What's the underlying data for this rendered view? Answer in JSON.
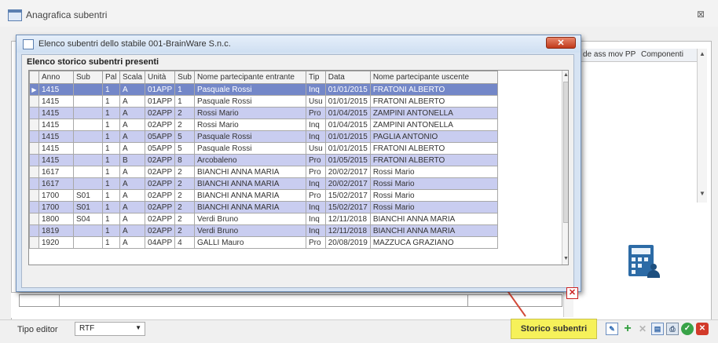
{
  "window": {
    "title": "Anagrafica subentri",
    "close_glyph": "⊠"
  },
  "background_grid": {
    "columns": [
      "de ass mov PP",
      "Componenti"
    ]
  },
  "dialog": {
    "title": "Elenco subentri dello stabile 001-BrainWare S.n.c.",
    "close_glyph": "✕",
    "group_title": "Elenco storico subentri presenti",
    "exit_glyph": "✕"
  },
  "table": {
    "columns": [
      "Anno",
      "Sub",
      "Pal",
      "Scala",
      "Unità",
      "Sub",
      "Nome partecipante entrante",
      "Tip",
      "Data",
      "Nome partecipante uscente"
    ],
    "rows": [
      [
        "1415",
        "",
        "1",
        "A",
        "01APP",
        "1",
        "Pasquale Rossi",
        "Inq",
        "01/01/2015",
        "FRATONI ALBERTO"
      ],
      [
        "1415",
        "",
        "1",
        "A",
        "01APP",
        "1",
        "Pasquale Rossi",
        "Usu",
        "01/01/2015",
        "FRATONI ALBERTO"
      ],
      [
        "1415",
        "",
        "1",
        "A",
        "02APP",
        "2",
        "Rossi Mario",
        "Pro",
        "01/04/2015",
        "ZAMPINI ANTONELLA"
      ],
      [
        "1415",
        "",
        "1",
        "A",
        "02APP",
        "2",
        "Rossi Mario",
        "Inq",
        "01/04/2015",
        "ZAMPINI ANTONELLA"
      ],
      [
        "1415",
        "",
        "1",
        "A",
        "05APP",
        "5",
        "Pasquale Rossi",
        "Inq",
        "01/01/2015",
        "PAGLIA ANTONIO"
      ],
      [
        "1415",
        "",
        "1",
        "A",
        "05APP",
        "5",
        "Pasquale Rossi",
        "Usu",
        "01/01/2015",
        "FRATONI ALBERTO"
      ],
      [
        "1415",
        "",
        "1",
        "B",
        "02APP",
        "8",
        "Arcobaleno",
        "Pro",
        "01/05/2015",
        "FRATONI ALBERTO"
      ],
      [
        "1617",
        "",
        "1",
        "A",
        "02APP",
        "2",
        "BIANCHI ANNA MARIA",
        "Pro",
        "20/02/2017",
        "Rossi Mario"
      ],
      [
        "1617",
        "",
        "1",
        "A",
        "02APP",
        "2",
        "BIANCHI ANNA MARIA",
        "Inq",
        "20/02/2017",
        "Rossi Mario"
      ],
      [
        "1700",
        "S01",
        "1",
        "A",
        "02APP",
        "2",
        "BIANCHI ANNA MARIA",
        "Pro",
        "15/02/2017",
        "Rossi Mario"
      ],
      [
        "1700",
        "S01",
        "1",
        "A",
        "02APP",
        "2",
        "BIANCHI ANNA MARIA",
        "Inq",
        "15/02/2017",
        "Rossi Mario"
      ],
      [
        "1800",
        "S04",
        "1",
        "A",
        "02APP",
        "2",
        "Verdi Bruno",
        "Inq",
        "12/11/2018",
        "BIANCHI ANNA MARIA"
      ],
      [
        "1819",
        "",
        "1",
        "A",
        "02APP",
        "2",
        "Verdi Bruno",
        "Inq",
        "12/11/2018",
        "BIANCHI ANNA MARIA"
      ],
      [
        "1920",
        "",
        "1",
        "A",
        "04APP",
        "4",
        "GALLI Mauro",
        "Pro",
        "20/08/2019",
        "MAZZUCA GRAZIANO"
      ]
    ],
    "current_row_marker": "▶",
    "scroll_up": "▲",
    "scroll_down": "▼"
  },
  "bottom_bar": {
    "tipo_editor_label": "Tipo editor",
    "tipo_editor_value": "RTF",
    "storico_button": "Storico subentri"
  }
}
